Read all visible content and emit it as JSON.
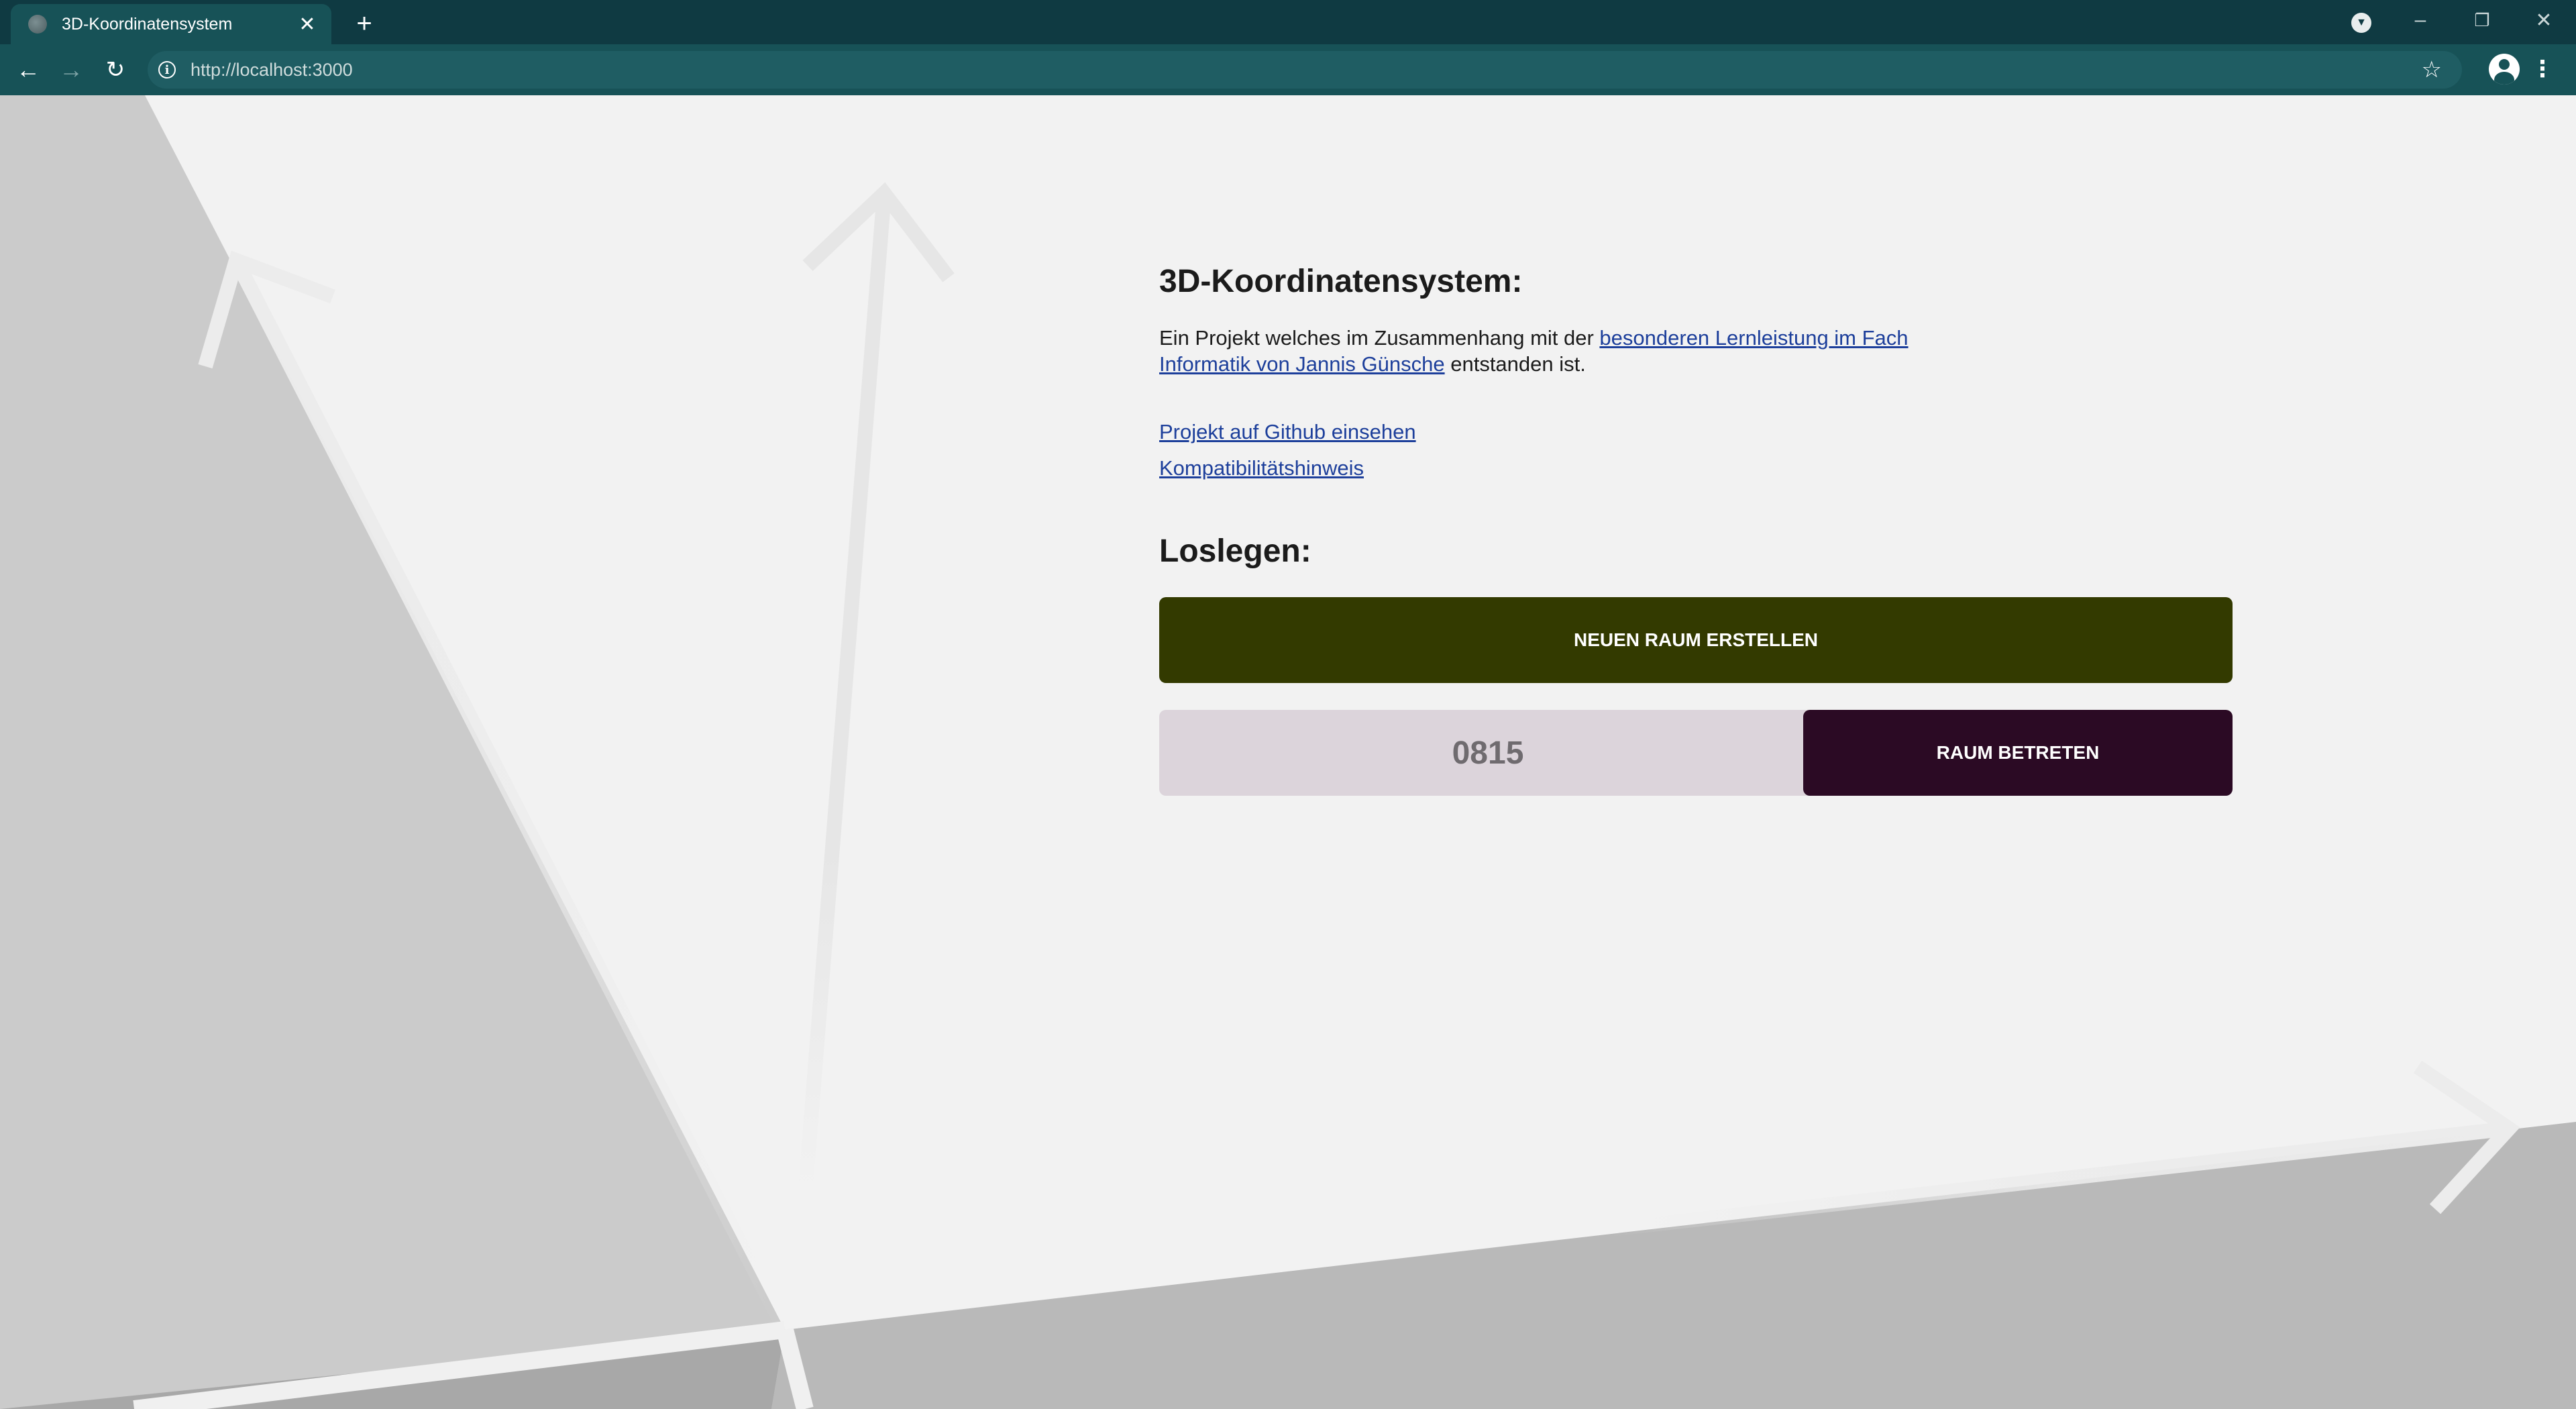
{
  "browser": {
    "tab_title": "3D-Koordinatensystem",
    "url": "http://localhost:3000"
  },
  "page": {
    "title": "3D-Koordinatensystem:",
    "intro_prefix": "Ein Projekt welches im Zusammenhang mit der ",
    "intro_link": "besonderen Lernleistung im Fach Informatik von Jannis Günsche",
    "intro_suffix": " entstanden ist.",
    "github_link": "Projekt auf Github einsehen",
    "compat_link": "Kompatibilitätshinweis",
    "start_heading": "Loslegen:",
    "create_button": "NEUEN RAUM ERSTELLEN",
    "room_placeholder": "0815",
    "join_button": "RAUM BETRETEN"
  },
  "colors": {
    "chrome_dark": "#0f3a42",
    "chrome_light": "#175257",
    "create_button": "#333a00",
    "join_button": "#2b0a24",
    "room_input": "#dcd4db",
    "link": "#1d3f9b"
  },
  "icons": {
    "tab": "globe-icon",
    "back": "arrow-left-icon",
    "forward": "arrow-right-icon",
    "reload": "reload-icon",
    "site_info": "info-icon",
    "bookmark": "star-icon",
    "profile": "account-icon",
    "menu": "kebab-menu-icon"
  }
}
